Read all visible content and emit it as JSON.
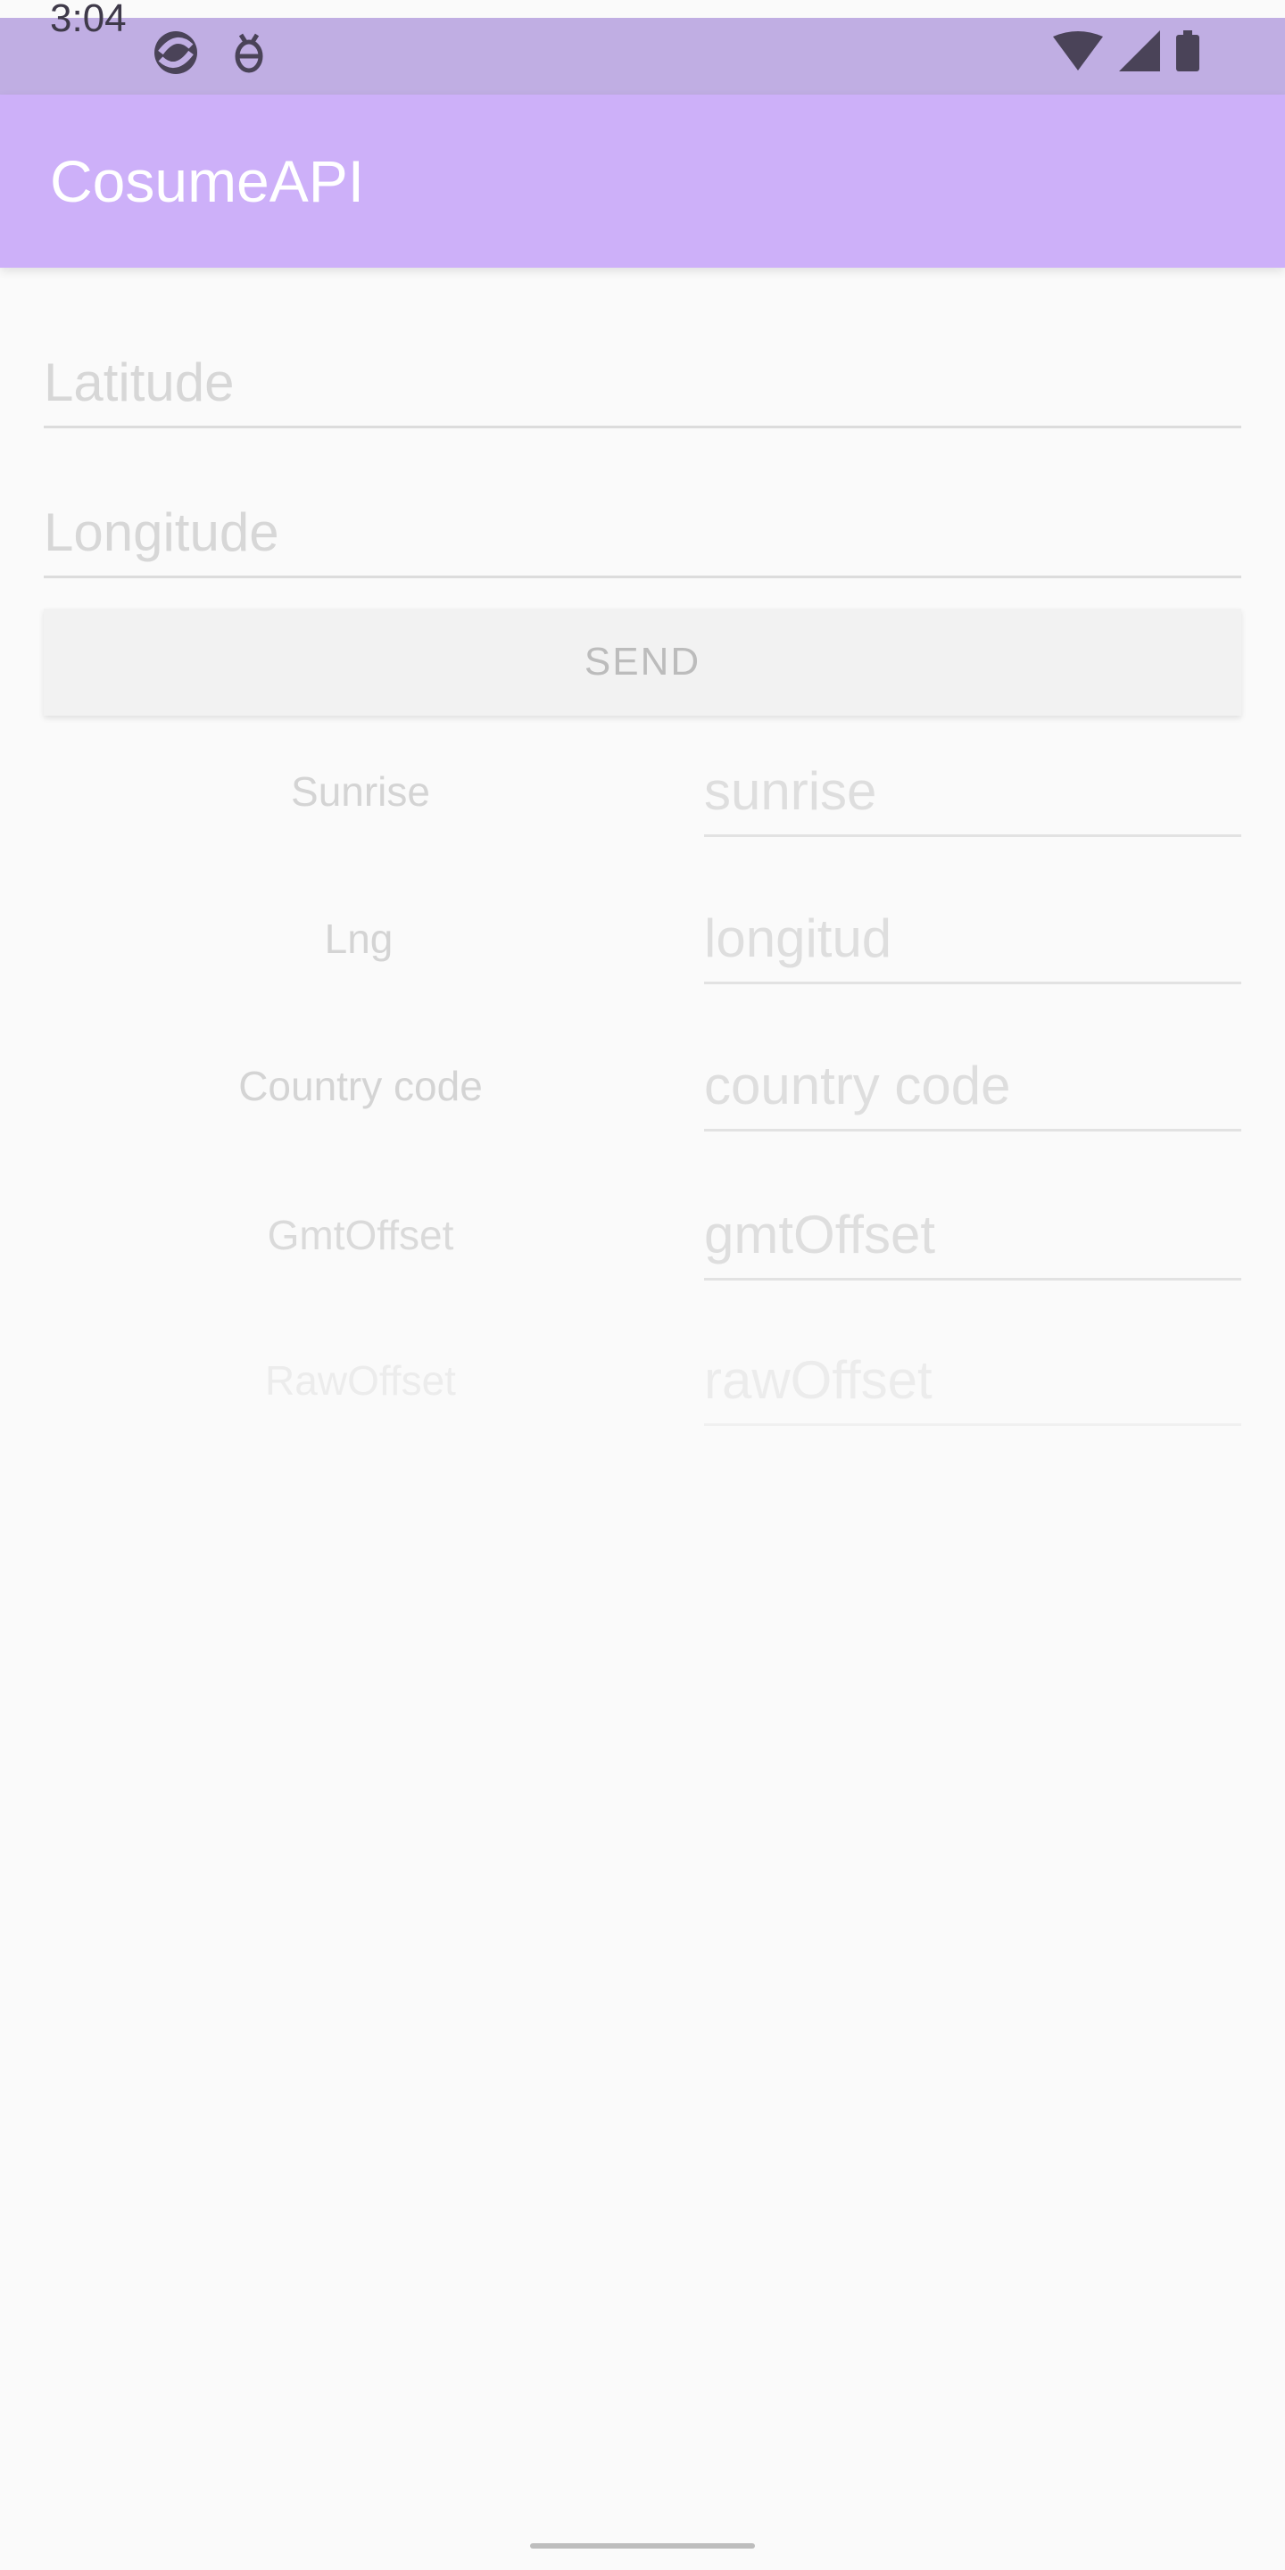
{
  "status_bar": {
    "time": "3:04",
    "left_icons": [
      "app-notification-icon",
      "debug-icon"
    ],
    "right_icons": [
      "wifi-icon",
      "signal-icon",
      "battery-icon"
    ]
  },
  "app_bar": {
    "title": "CosumeAPI"
  },
  "inputs": {
    "latitude_placeholder": "Latitude",
    "longitude_placeholder": "Longitude"
  },
  "send_button": {
    "label": "SEND"
  },
  "results": [
    {
      "label": "Sunrise",
      "placeholder": "sunrise"
    },
    {
      "label": "Lng",
      "placeholder": "longitud"
    },
    {
      "label": "Country code",
      "placeholder": "country code"
    },
    {
      "label": "GmtOffset",
      "placeholder": "gmtOffset"
    },
    {
      "label": "RawOffset",
      "placeholder": "rawOffset"
    }
  ],
  "colors": {
    "status_bar": "#c0aee3",
    "app_bar": "#cdb0f9",
    "background": "#fafafa"
  }
}
